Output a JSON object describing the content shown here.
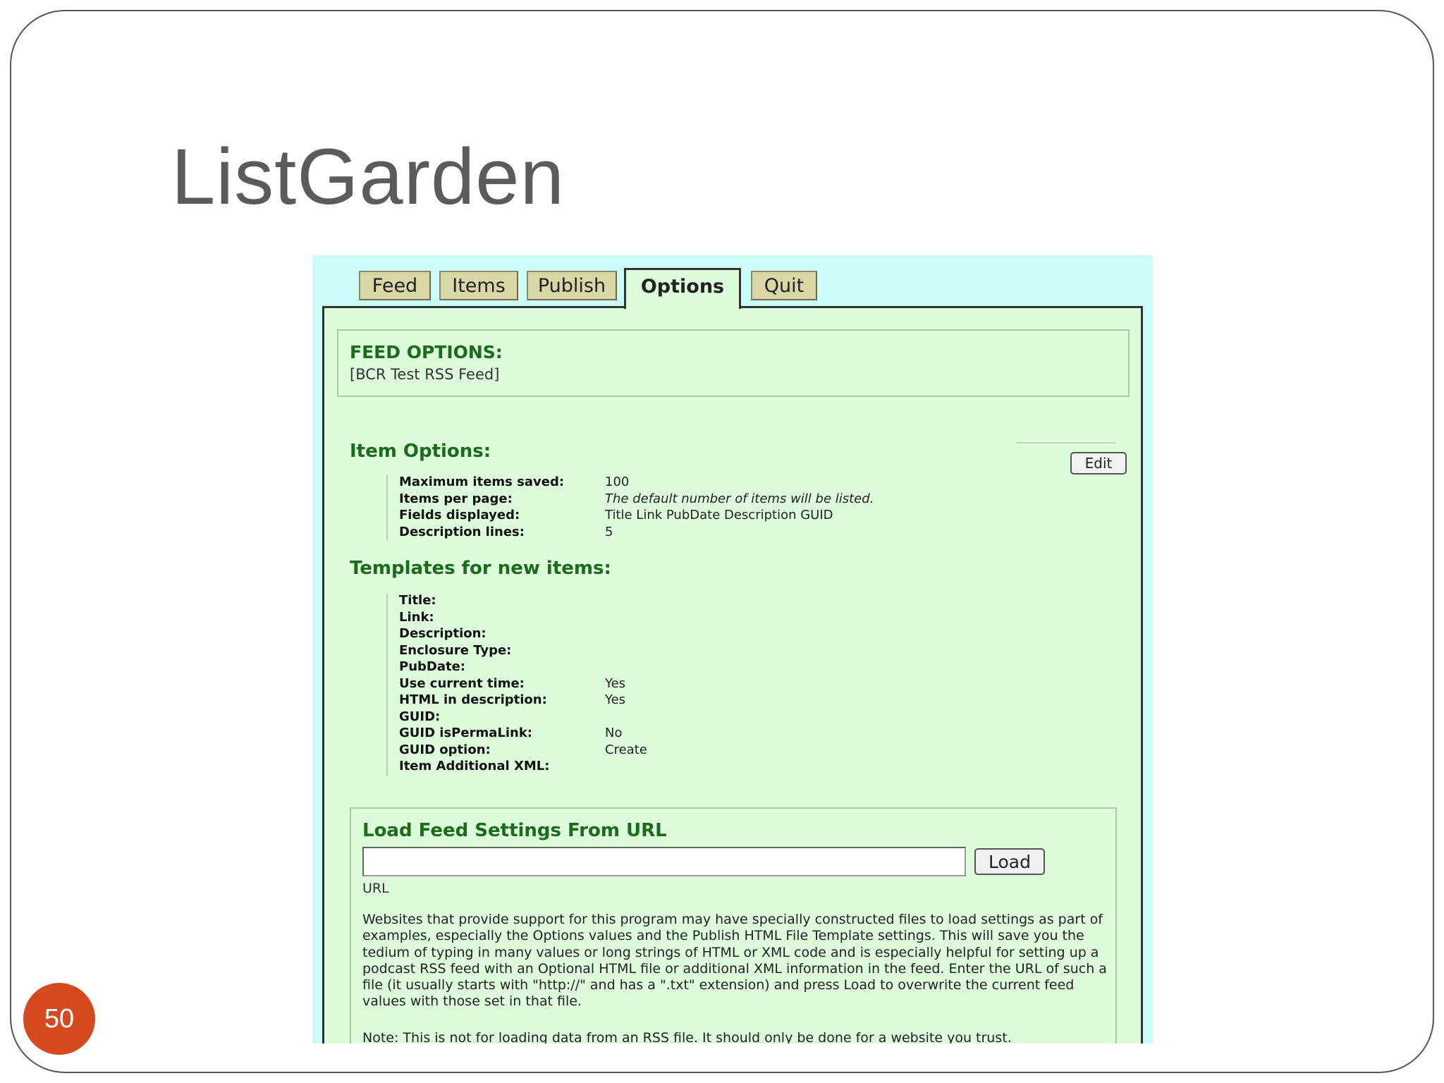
{
  "slide": {
    "title": "ListGarden",
    "page_number": "50",
    "accent_color": "#d5491f"
  },
  "app": {
    "tabs": [
      {
        "label": "Feed",
        "active": false
      },
      {
        "label": "Items",
        "active": false
      },
      {
        "label": "Publish",
        "active": false
      },
      {
        "label": "Options",
        "active": true
      },
      {
        "label": "Quit",
        "active": false
      }
    ],
    "feed_options": {
      "heading": "FEED OPTIONS:",
      "feed_name": "[BCR Test RSS Feed]"
    },
    "item_options": {
      "heading": "Item Options:",
      "edit_label": "Edit",
      "rows": [
        {
          "label": "Maximum items saved:",
          "value": "100",
          "italic": false
        },
        {
          "label": "Items per page:",
          "value": "The default number of items will be listed.",
          "italic": true
        },
        {
          "label": "Fields displayed:",
          "value": "Title Link PubDate Description GUID",
          "italic": false
        },
        {
          "label": "Description lines:",
          "value": "5",
          "italic": false
        }
      ]
    },
    "templates": {
      "heading": "Templates for new items:",
      "rows": [
        {
          "label": "Title:",
          "value": ""
        },
        {
          "label": "Link:",
          "value": ""
        },
        {
          "label": "Description:",
          "value": ""
        },
        {
          "label": "Enclosure Type:",
          "value": ""
        },
        {
          "label": "PubDate:",
          "value": ""
        },
        {
          "label": "Use current time:",
          "value": "Yes"
        },
        {
          "label": "HTML in description:",
          "value": "Yes"
        },
        {
          "label": "GUID:",
          "value": ""
        },
        {
          "label": "GUID isPermaLink:",
          "value": "No"
        },
        {
          "label": "GUID option:",
          "value": "Create"
        },
        {
          "label": "Item Additional XML:",
          "value": ""
        }
      ]
    },
    "load_settings": {
      "heading": "Load Feed Settings From URL",
      "url_value": "",
      "load_label": "Load",
      "url_label": "URL",
      "help_text": "Websites that provide support for this program may have specially constructed files to load settings as part of examples, especially the Options values and the Publish HTML File Template settings. This will save you the tedium of typing in many values or long strings of HTML or XML code and is especially helpful for setting up a podcast RSS feed with an Optional HTML file or additional XML information in the feed. Enter the URL of such a file (it usually starts with \"http://\" and has a \".txt\" extension) and press Load to overwrite the current feed values with those set in that file.",
      "help_text_cut": "Note: This is not for loading data from an RSS file. It should only be done for a website you trust."
    }
  }
}
